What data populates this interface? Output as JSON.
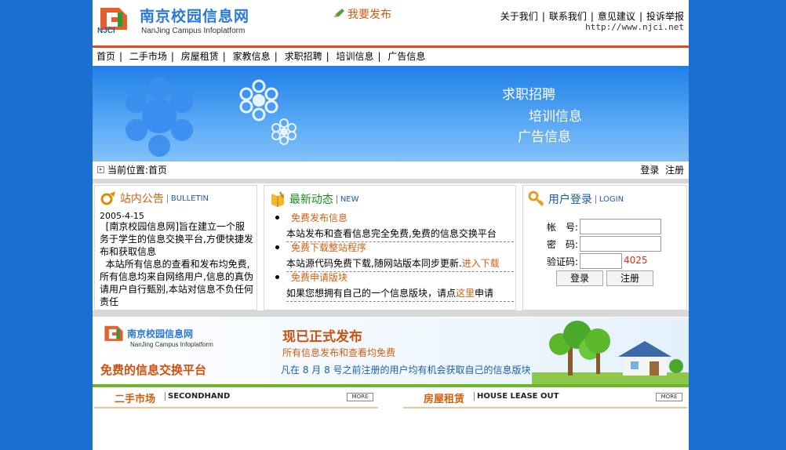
{
  "header": {
    "logo_mark": "NJCI",
    "site_title": "南京校园信息网",
    "site_subtitle": "NanJing Campus Infoplatform",
    "publish_label": "我要发布",
    "top_links": [
      "关于我们",
      "联系我们",
      "意见建议",
      "投诉举报"
    ],
    "site_url": "http://www.njci.net",
    "accent_color": "#d84f18"
  },
  "nav": {
    "items": [
      "首页",
      "二手市场",
      "房屋租赁",
      "家教信息",
      "求职招聘",
      "培训信息",
      "广告信息"
    ]
  },
  "banner": {
    "lines": [
      "求职招聘",
      "培训信息",
      "广告信息"
    ]
  },
  "location": {
    "prefix": "当前位置:",
    "current": "首页",
    "login": "登录",
    "register": "注册"
  },
  "bulletin": {
    "title_cn": "站内公告",
    "title_en": "BULLETIN",
    "date": "2005-4-15",
    "body": "  [南京校园信息网]旨在建立一个服务于学生的信息交换平台,方便快捷发布和获取信息\n  本站所有信息的查看和发布均免费,所有信息均来自网络用户,信息的真伪请用户自行甄别,本站对信息不负任何责任"
  },
  "news": {
    "title_cn": "最新动态",
    "title_en": "NEW",
    "items": [
      {
        "title": "免费发布信息",
        "desc": "本站发布和查看信息完全免费,免费的信息交换平台",
        "link": ""
      },
      {
        "title": "免费下载整站程序",
        "desc": "本站源代码免费下载,随网站版本同步更新.",
        "link": "进入下载"
      },
      {
        "title": "免费申请版块",
        "desc": "如果您想拥有自己的一个信息版块，请点",
        "link": "这里",
        "tail": "申请"
      }
    ]
  },
  "login": {
    "title_cn": "用户登录",
    "title_en": "LOGIN",
    "account_label": "帐　号:",
    "password_label": "密　码:",
    "captcha_label": "验证码:",
    "captcha_code": "4025",
    "login_button": "登录",
    "register_button": "注册"
  },
  "promo": {
    "logo_title": "南京校园信息网",
    "logo_subtitle": "NanJing Campus Infoplatform",
    "slogan": "免费的信息交换平台",
    "headline": "现已正式发布",
    "line2": "所有信息发布和查看均免费",
    "line3": "凡在 8 月 8 号之前注册的用户均有机会获取自己的信息版块"
  },
  "sections": [
    {
      "title_cn": "二手市场",
      "title_en": "SECONDHAND",
      "more": "MORE"
    },
    {
      "title_cn": "房屋租赁",
      "title_en": "HOUSE LEASE OUT",
      "more": "MORE"
    }
  ]
}
